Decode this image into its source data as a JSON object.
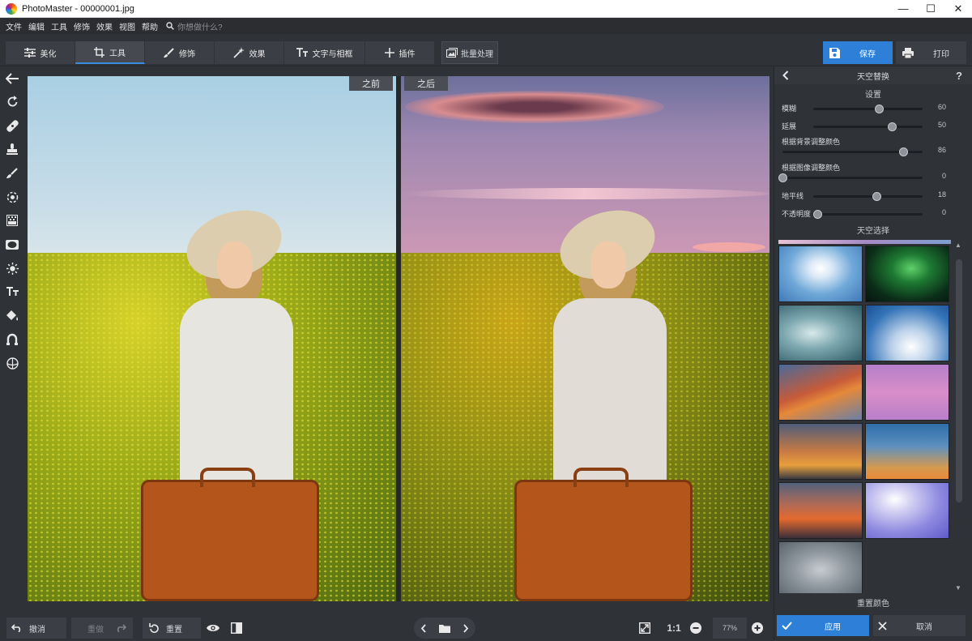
{
  "window": {
    "title": "PhotoMaster - 00000001.jpg",
    "minimize": "—",
    "maximize": "☐",
    "close": "✕"
  },
  "menu": {
    "items": [
      "文件",
      "编辑",
      "工具",
      "修饰",
      "效果",
      "视图",
      "帮助"
    ],
    "search_placeholder": "你想做什么?"
  },
  "tabs": [
    {
      "label": "美化",
      "icon": "sliders-icon"
    },
    {
      "label": "工具",
      "icon": "crop-icon"
    },
    {
      "label": "修饰",
      "icon": "brush-icon"
    },
    {
      "label": "效果",
      "icon": "magic-wand-icon"
    },
    {
      "label": "文字与相框",
      "icon": "text-icon"
    },
    {
      "label": "插件",
      "icon": "plus-icon"
    }
  ],
  "active_tab": "工具",
  "batch_label": "批量处理",
  "save_label": "保存",
  "print_label": "打印",
  "canvas": {
    "before_label": "之前",
    "after_label": "之后"
  },
  "bottom": {
    "undo_label": "撤消",
    "redo_label": "重做",
    "reset_label": "重置",
    "zoom_value": "77%",
    "one_to_one": "1:1"
  },
  "panel": {
    "title": "天空替换",
    "help": "?",
    "settings_label": "设置",
    "sliders": [
      {
        "name": "模糊",
        "value": 60
      },
      {
        "name": "延展",
        "value": 50
      }
    ],
    "sliders_long": [
      {
        "name": "根据背景调整颜色",
        "value": 86
      },
      {
        "name": "根据图像调整颜色",
        "value": 0
      }
    ],
    "sliders2": [
      {
        "name": "地平线",
        "value": 18
      },
      {
        "name": "不透明度",
        "value": 0
      }
    ],
    "sky_select_label": "天空选择",
    "reset_sky_label": "重置颜色",
    "apply_label": "应用",
    "cancel_label": "取消"
  },
  "colors": {
    "accent": "#2d7fd8",
    "bg": "#2f3237",
    "tab": "#3b3e44"
  }
}
